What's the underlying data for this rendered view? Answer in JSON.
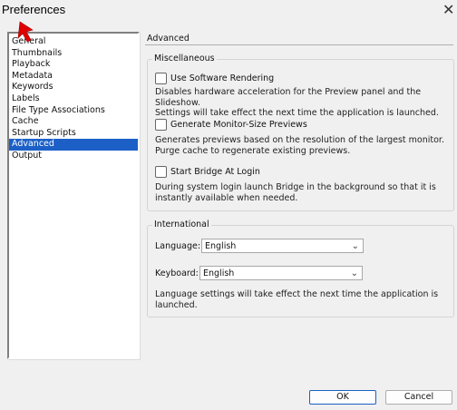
{
  "window": {
    "title": "Preferences",
    "close_glyph": "✕"
  },
  "sidebar": {
    "items": [
      {
        "label": "General"
      },
      {
        "label": "Thumbnails"
      },
      {
        "label": "Playback"
      },
      {
        "label": "Metadata"
      },
      {
        "label": "Keywords"
      },
      {
        "label": "Labels"
      },
      {
        "label": "File Type Associations"
      },
      {
        "label": "Cache"
      },
      {
        "label": "Startup Scripts"
      },
      {
        "label": "Advanced"
      },
      {
        "label": "Output"
      }
    ],
    "selected": "Advanced"
  },
  "panel": {
    "title": "Advanced",
    "misc": {
      "label": "Miscellaneous",
      "software_rendering": {
        "label": "Use Software Rendering",
        "checked": false,
        "desc_1": "Disables hardware acceleration for the Preview panel and the Slideshow.",
        "desc_2": "Settings will take effect the next time the application is launched."
      },
      "monitor_previews": {
        "label": "Generate Monitor-Size Previews",
        "checked": false,
        "desc_1": "Generates previews based on the resolution of the largest monitor.",
        "desc_2": "Purge cache to regenerate existing previews."
      },
      "bridge_login": {
        "label": "Start Bridge At Login",
        "checked": false,
        "desc_1": "During system login launch Bridge in the background so that it is",
        "desc_2": "instantly available when needed."
      }
    },
    "intl": {
      "label": "International",
      "language_label": "Language:",
      "language_value": "English",
      "keyboard_label": "Keyboard:",
      "keyboard_value": "English",
      "note_1": "Language settings will take effect the next time the application is",
      "note_2": "launched."
    }
  },
  "buttons": {
    "ok": "OK",
    "cancel": "Cancel"
  },
  "colors": {
    "selection": "#1c60c7",
    "cursor": "#e00000"
  }
}
